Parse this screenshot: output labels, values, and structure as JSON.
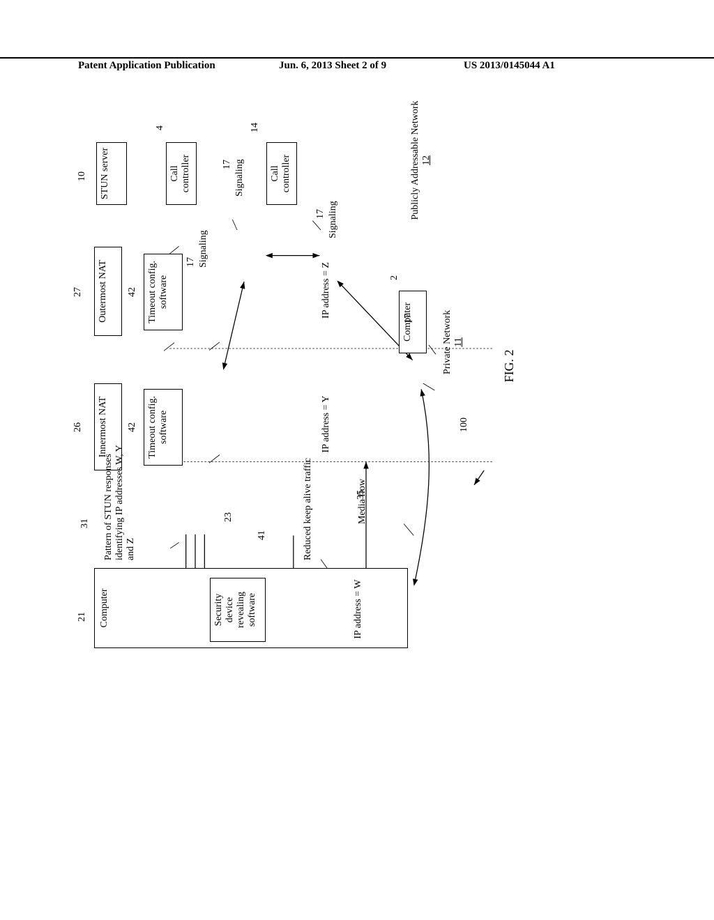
{
  "header": {
    "left": "Patent Application Publication",
    "center": "Jun. 6, 2013  Sheet 2 of 9",
    "right": "US 2013/0145044 A1"
  },
  "blocks": {
    "computer21": "Computer",
    "securitySoftware": "Security device revealing software",
    "ipW": "IP address = W",
    "innermostNat": "Innermost NAT",
    "outermostNat": "Outermost NAT",
    "timeoutConfig": "Timeout config. software",
    "ipY": "IP address = Y",
    "ipZ": "IP address = Z",
    "stunServer": "STUN server",
    "callController": "Call controller",
    "computer2": "Computer"
  },
  "labels": {
    "stunPattern": "Pattern of STUN responses identifying IP addresses W, Y and Z",
    "keepAlive": "Reduced keep alive traffic",
    "mediaFlow": "Media flow",
    "signaling": "Signaling",
    "privateNetwork": "Private Network",
    "publicNetwork": "Publicly Addressable Network",
    "figure": "FIG. 2"
  },
  "refs": {
    "r21": "21",
    "r31": "31",
    "r26": "26",
    "r27": "27",
    "r10": "10",
    "r42": "42",
    "r4": "4",
    "r14": "14",
    "r2": "2",
    "r17": "17",
    "r23": "23",
    "r41": "41",
    "r35": "35",
    "r100": "100",
    "r11": "11",
    "r12": "12"
  }
}
